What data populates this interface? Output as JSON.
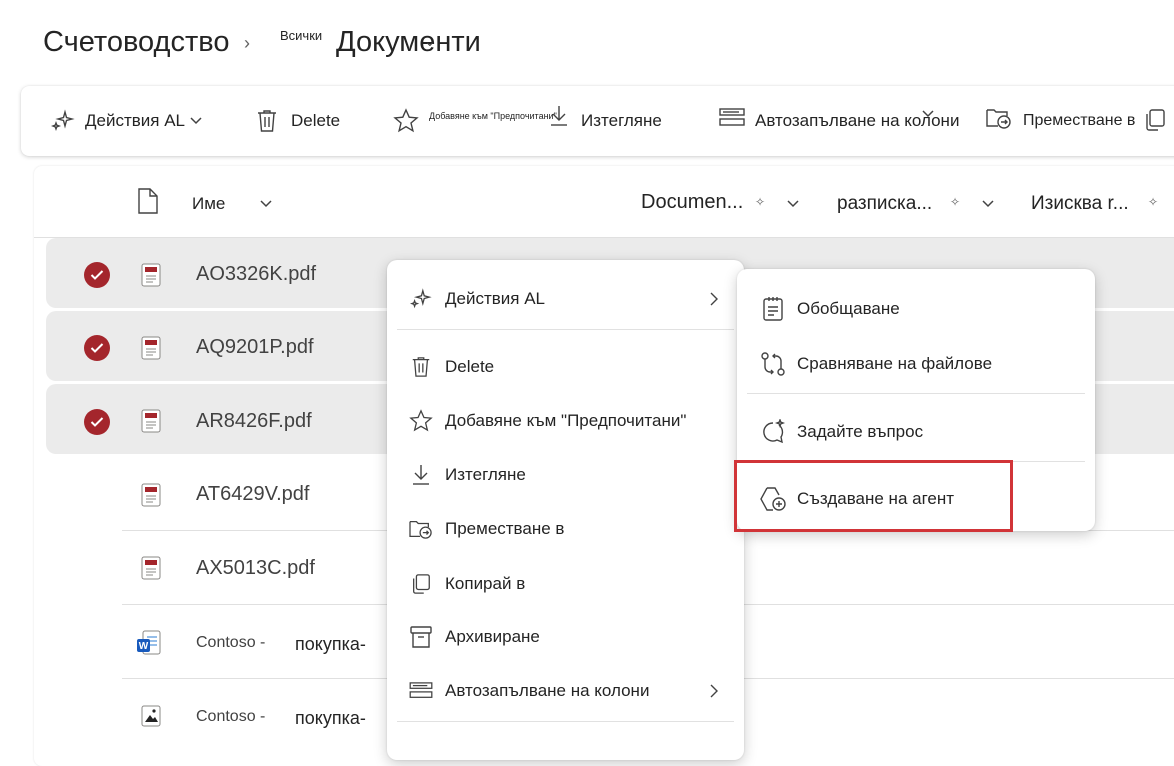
{
  "breadcrumb": {
    "root": "Счетоводство",
    "small": "Всички",
    "current": "Документи"
  },
  "toolbar": {
    "ai_actions": "Действия AL",
    "delete": "Delete",
    "favorites": "Добавяне към \"Предпочитани\"",
    "download": "Изтегляне",
    "autofill": "Автозапълване на колони",
    "move": "Преместване в"
  },
  "columns": {
    "name": "Име",
    "document": "Documen...",
    "receipt": "разписка...",
    "requires": "Изисква r..."
  },
  "files": [
    {
      "name": "AO3326K.pdf",
      "selected": true,
      "type": "pdf"
    },
    {
      "name": "AQ9201P.pdf",
      "selected": true,
      "type": "pdf"
    },
    {
      "name": "AR8426F.pdf",
      "selected": true,
      "type": "pdf"
    },
    {
      "name": "AT6429V.pdf",
      "selected": false,
      "type": "pdf"
    },
    {
      "name": "AX5013C.pdf",
      "selected": false,
      "type": "pdf"
    },
    {
      "name_a": "Contoso -",
      "name_b": "покупка-",
      "selected": false,
      "type": "word"
    },
    {
      "name_a": "Contoso -",
      "name_b": "покупка-",
      "selected": false,
      "type": "image"
    }
  ],
  "context_menu": {
    "ai_actions": "Действия AL",
    "delete": "Delete",
    "favorites": "Добавяне към \"Предпочитани\"",
    "download": "Изтегляне",
    "move": "Преместване в",
    "copy": "Копирай в",
    "archive": "Архивиране",
    "autofill": "Автозапълване на колони"
  },
  "submenu": {
    "summarize": "Обобщаване",
    "compare": "Сравняване на файлове",
    "ask": "Задайте въпрос",
    "create_agent": "Създаване на агент"
  },
  "colors": {
    "check": "#a4262c",
    "highlight": "#d13438",
    "selected_row": "#ebebeb"
  }
}
